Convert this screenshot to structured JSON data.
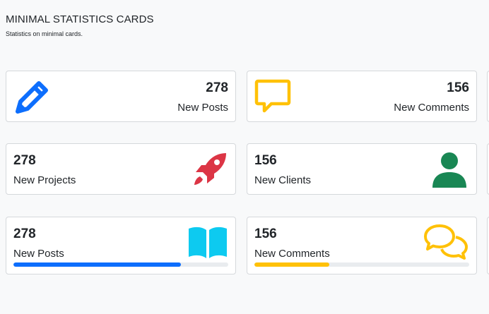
{
  "header": {
    "title": "MINIMAL STATISTICS CARDS",
    "subtitle": "Statistics on minimal cards."
  },
  "colors": {
    "blue": "#0d6efd",
    "yellow": "#ffc107",
    "red": "#dc3545",
    "green": "#198754",
    "cyan": "#0dcaf0"
  },
  "rows": [
    {
      "cards": [
        {
          "value": "278",
          "label": "New Posts",
          "icon": "pencil-icon"
        },
        {
          "value": "156",
          "label": "New Comments",
          "icon": "speech-bubble-icon"
        }
      ]
    },
    {
      "cards": [
        {
          "value": "278",
          "label": "New Projects",
          "icon": "rocket-icon"
        },
        {
          "value": "156",
          "label": "New Clients",
          "icon": "user-icon"
        }
      ]
    },
    {
      "cards": [
        {
          "value": "278",
          "label": "New Posts",
          "icon": "book-icon",
          "progress": 0.78
        },
        {
          "value": "156",
          "label": "New Comments",
          "icon": "chat-bubbles-icon",
          "progress": 0.35
        }
      ]
    }
  ]
}
